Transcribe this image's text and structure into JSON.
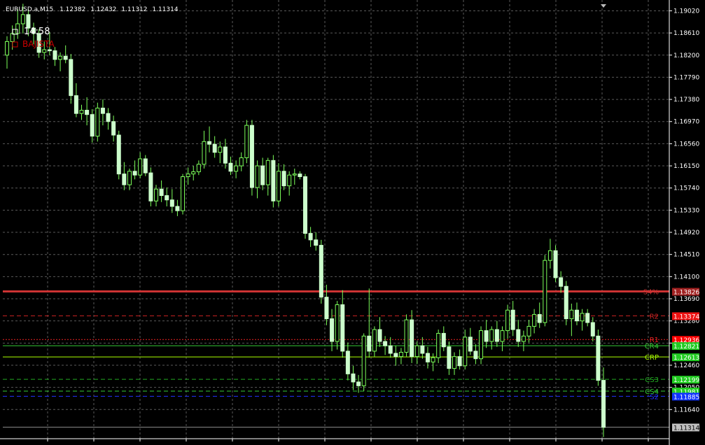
{
  "header": {
    "symbol": "EURUSD.a,M15",
    "open": "1.12382",
    "high": "1.12432",
    "low": "1.11312",
    "close": "1.11314"
  },
  "overlay": {
    "countdown": "14:58",
    "trend_label": "BAJISTA",
    "trend_color": "#cc0000",
    "countdown_color": "#ffffff"
  },
  "chart_data": {
    "type": "candlestick",
    "ylim": [
      1.111,
      1.1922
    ],
    "y_ticks": [
      "1.19020",
      "1.18610",
      "1.18200",
      "1.17790",
      "1.17380",
      "1.16970",
      "1.16560",
      "1.16150",
      "1.15740",
      "1.15330",
      "1.14920",
      "1.14510",
      "1.14100",
      "1.13690",
      "1.13280",
      "1.12870",
      "1.12460",
      "1.12050",
      "1.11640"
    ],
    "grid": true,
    "up_color": "#ccffcc",
    "down_color": "#ccffcc",
    "candles": [
      [
        1.182,
        1.1855,
        1.1795,
        1.1845
      ],
      [
        1.1845,
        1.1875,
        1.183,
        1.186
      ],
      [
        1.186,
        1.1905,
        1.185,
        1.1878
      ],
      [
        1.1878,
        1.1915,
        1.186,
        1.1895
      ],
      [
        1.1895,
        1.1905,
        1.1855,
        1.187
      ],
      [
        1.187,
        1.188,
        1.184,
        1.186
      ],
      [
        1.186,
        1.1868,
        1.1815,
        1.1825
      ],
      [
        1.1825,
        1.1845,
        1.1812,
        1.183
      ],
      [
        1.183,
        1.1862,
        1.182,
        1.1828
      ],
      [
        1.1828,
        1.1835,
        1.18,
        1.1812
      ],
      [
        1.1812,
        1.1825,
        1.179,
        1.1818
      ],
      [
        1.1818,
        1.1838,
        1.1805,
        1.1812
      ],
      [
        1.1812,
        1.1822,
        1.173,
        1.1745
      ],
      [
        1.1745,
        1.1768,
        1.1705,
        1.1712
      ],
      [
        1.1712,
        1.1728,
        1.17,
        1.1718
      ],
      [
        1.1718,
        1.1742,
        1.169,
        1.171
      ],
      [
        1.171,
        1.172,
        1.1658,
        1.167
      ],
      [
        1.167,
        1.1732,
        1.166,
        1.1722
      ],
      [
        1.1722,
        1.1738,
        1.169,
        1.1712
      ],
      [
        1.1712,
        1.1722,
        1.1682,
        1.1697
      ],
      [
        1.1697,
        1.1708,
        1.166,
        1.1672
      ],
      [
        1.1672,
        1.168,
        1.159,
        1.16
      ],
      [
        1.16,
        1.1622,
        1.157,
        1.158
      ],
      [
        1.158,
        1.161,
        1.157,
        1.1605
      ],
      [
        1.1605,
        1.1625,
        1.159,
        1.1598
      ],
      [
        1.1598,
        1.164,
        1.1592,
        1.1628
      ],
      [
        1.1628,
        1.1635,
        1.1596,
        1.1602
      ],
      [
        1.1602,
        1.1612,
        1.154,
        1.155
      ],
      [
        1.155,
        1.158,
        1.154,
        1.1572
      ],
      [
        1.1572,
        1.1588,
        1.1548,
        1.156
      ],
      [
        1.156,
        1.1575,
        1.154,
        1.1552
      ],
      [
        1.1552,
        1.1572,
        1.1528,
        1.154
      ],
      [
        1.154,
        1.1552,
        1.1522,
        1.1532
      ],
      [
        1.1532,
        1.16,
        1.1525,
        1.1595
      ],
      [
        1.1595,
        1.1612,
        1.158,
        1.16
      ],
      [
        1.16,
        1.1615,
        1.1588,
        1.1604
      ],
      [
        1.1604,
        1.1625,
        1.1598,
        1.1618
      ],
      [
        1.1618,
        1.168,
        1.161,
        1.166
      ],
      [
        1.166,
        1.1688,
        1.164,
        1.1655
      ],
      [
        1.1655,
        1.167,
        1.163,
        1.164
      ],
      [
        1.164,
        1.166,
        1.162,
        1.165
      ],
      [
        1.165,
        1.1665,
        1.161,
        1.162
      ],
      [
        1.162,
        1.1632,
        1.1598,
        1.1605
      ],
      [
        1.1605,
        1.1625,
        1.1592,
        1.1615
      ],
      [
        1.1615,
        1.164,
        1.1605,
        1.163
      ],
      [
        1.163,
        1.17,
        1.162,
        1.169
      ],
      [
        1.169,
        1.17,
        1.156,
        1.1575
      ],
      [
        1.1575,
        1.1625,
        1.1555,
        1.1615
      ],
      [
        1.1615,
        1.163,
        1.157,
        1.158
      ],
      [
        1.158,
        1.163,
        1.156,
        1.1625
      ],
      [
        1.1625,
        1.1635,
        1.1538,
        1.155
      ],
      [
        1.155,
        1.162,
        1.154,
        1.1605
      ],
      [
        1.1605,
        1.1618,
        1.157,
        1.1578
      ],
      [
        1.1578,
        1.1605,
        1.156,
        1.1598
      ],
      [
        1.1598,
        1.161,
        1.158,
        1.16
      ],
      [
        1.16,
        1.1605,
        1.159,
        1.1595
      ],
      [
        1.1595,
        1.16,
        1.148,
        1.149
      ],
      [
        1.149,
        1.1502,
        1.1465,
        1.1478
      ],
      [
        1.1478,
        1.1492,
        1.1458,
        1.1468
      ],
      [
        1.1468,
        1.1478,
        1.136,
        1.1372
      ],
      [
        1.1372,
        1.1395,
        1.132,
        1.1332
      ],
      [
        1.1332,
        1.135,
        1.1272,
        1.129
      ],
      [
        1.129,
        1.1365,
        1.1275,
        1.1358
      ],
      [
        1.1358,
        1.1385,
        1.126,
        1.1272
      ],
      [
        1.1272,
        1.1288,
        1.1218,
        1.123
      ],
      [
        1.123,
        1.1245,
        1.12,
        1.1215
      ],
      [
        1.1215,
        1.1228,
        1.1195,
        1.1208
      ],
      [
        1.1208,
        1.1305,
        1.1198,
        1.13
      ],
      [
        1.13,
        1.1388,
        1.126,
        1.1272
      ],
      [
        1.1272,
        1.1318,
        1.1262,
        1.1312
      ],
      [
        1.1312,
        1.1335,
        1.128,
        1.129
      ],
      [
        1.129,
        1.13,
        1.1265,
        1.1282
      ],
      [
        1.1282,
        1.1298,
        1.126,
        1.1268
      ],
      [
        1.1268,
        1.1282,
        1.1245,
        1.1262
      ],
      [
        1.1262,
        1.1278,
        1.1248,
        1.127
      ],
      [
        1.127,
        1.134,
        1.1262,
        1.133
      ],
      [
        1.133,
        1.1348,
        1.125,
        1.1262
      ],
      [
        1.1262,
        1.129,
        1.1248,
        1.1282
      ],
      [
        1.1282,
        1.1298,
        1.1258,
        1.1268
      ],
      [
        1.1268,
        1.128,
        1.124,
        1.1252
      ],
      [
        1.1252,
        1.1268,
        1.1235,
        1.126
      ],
      [
        1.126,
        1.1312,
        1.125,
        1.1305
      ],
      [
        1.1305,
        1.1318,
        1.1272,
        1.128
      ],
      [
        1.128,
        1.129,
        1.1228,
        1.124
      ],
      [
        1.124,
        1.127,
        1.1228,
        1.1262
      ],
      [
        1.1262,
        1.1275,
        1.1238,
        1.1245
      ],
      [
        1.1245,
        1.1312,
        1.1238,
        1.1298
      ],
      [
        1.1298,
        1.1315,
        1.1265,
        1.1272
      ],
      [
        1.1272,
        1.1285,
        1.1248,
        1.1258
      ],
      [
        1.1258,
        1.1318,
        1.1248,
        1.131
      ],
      [
        1.131,
        1.133,
        1.1278,
        1.129
      ],
      [
        1.129,
        1.1318,
        1.1275,
        1.1312
      ],
      [
        1.1312,
        1.1328,
        1.128,
        1.129
      ],
      [
        1.129,
        1.1318,
        1.1272,
        1.131
      ],
      [
        1.131,
        1.1358,
        1.1295,
        1.1348
      ],
      [
        1.1348,
        1.1365,
        1.13,
        1.1312
      ],
      [
        1.1312,
        1.133,
        1.128,
        1.129
      ],
      [
        1.129,
        1.131,
        1.1272,
        1.13
      ],
      [
        1.13,
        1.133,
        1.1288,
        1.1318
      ],
      [
        1.1318,
        1.135,
        1.1305,
        1.134
      ],
      [
        1.134,
        1.1362,
        1.1315,
        1.1325
      ],
      [
        1.1325,
        1.145,
        1.1318,
        1.144
      ],
      [
        1.144,
        1.148,
        1.1425,
        1.1458
      ],
      [
        1.1458,
        1.1468,
        1.14,
        1.1408
      ],
      [
        1.1408,
        1.142,
        1.138,
        1.1392
      ],
      [
        1.1392,
        1.1402,
        1.132,
        1.1332
      ],
      [
        1.1332,
        1.136,
        1.13,
        1.1348
      ],
      [
        1.1348,
        1.1362,
        1.132,
        1.1328
      ],
      [
        1.1328,
        1.135,
        1.131,
        1.1342
      ],
      [
        1.1342,
        1.135,
        1.1318,
        1.1325
      ],
      [
        1.1325,
        1.1335,
        1.129,
        1.13
      ],
      [
        1.13,
        1.1312,
        1.1208,
        1.1218
      ],
      [
        1.1218,
        1.1242,
        1.1113,
        1.1131
      ]
    ],
    "horizontal_lines": [
      {
        "label": "S4%",
        "price": "1.13826",
        "value": 1.13826,
        "color": "#cc3333",
        "style": "solid",
        "badge": "#a02020"
      },
      {
        "label": "R2",
        "price": "1.13374",
        "value": 1.13374,
        "color": "#cc2222",
        "style": "dashed",
        "badge": "#ee1111"
      },
      {
        "label": "R1",
        "price": "1.12936",
        "value": 1.12936,
        "color": "#ee2222",
        "style": "dotted",
        "badge": "#ff0000"
      },
      {
        "label": "CR4",
        "price": "1.12821",
        "value": 1.12821,
        "color": "#33cc33",
        "style": "solid",
        "badge": "#22cc22"
      },
      {
        "label": "CRP",
        "price": "1.12613",
        "value": 1.12613,
        "color": "#aaff00",
        "style": "solid",
        "badge": "#22cc22"
      },
      {
        "label": "CS3",
        "price": "1.12199",
        "value": 1.12199,
        "color": "#22aa22",
        "style": "dashed",
        "badge": "#22cc22"
      },
      {
        "label": "CS4",
        "price": "1.11981",
        "value": 1.11981,
        "color": "#33cc33",
        "style": "dashed",
        "badge": "#22cc22"
      },
      {
        "label": "S2",
        "price": "1.11885",
        "value": 1.11885,
        "color": "#2233ff",
        "style": "dashed",
        "badge": "#1133ff"
      }
    ],
    "last_price": {
      "price": "1.11314",
      "value": 1.11314
    }
  }
}
